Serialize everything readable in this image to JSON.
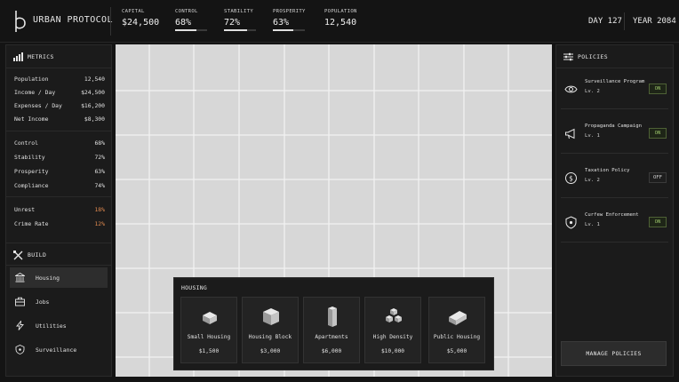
{
  "app": {
    "title": "URBAN PROTOCOL"
  },
  "topbar": {
    "stats": [
      {
        "label": "CAPITAL",
        "value": "$24,500"
      },
      {
        "label": "CONTROL",
        "value": "68%",
        "level": 0.68
      },
      {
        "label": "STABILITY",
        "value": "72%",
        "level": 0.72
      },
      {
        "label": "PROSPERITY",
        "value": "63%",
        "level": 0.63
      },
      {
        "label": "POPULATION",
        "value": "12,540"
      }
    ],
    "day": "DAY 127",
    "year": "YEAR 2084"
  },
  "metrics": {
    "title": "METRICS",
    "economy": [
      {
        "label": "Population",
        "value": "12,540"
      },
      {
        "label": "Income / Day",
        "value": "$24,500"
      },
      {
        "label": "Expenses / Day",
        "value": "$16,200"
      },
      {
        "label": "Net Income",
        "value": "$8,300"
      }
    ],
    "indices": [
      {
        "label": "Control",
        "value": "68%"
      },
      {
        "label": "Stability",
        "value": "72%"
      },
      {
        "label": "Prosperity",
        "value": "63%"
      },
      {
        "label": "Compliance",
        "value": "74%"
      }
    ],
    "risks": [
      {
        "label": "Unrest",
        "value": "18%"
      },
      {
        "label": "Crime Rate",
        "value": "12%"
      }
    ]
  },
  "build": {
    "title": "BUILD",
    "items": [
      {
        "label": "Housing",
        "icon": "building-columns-icon",
        "active": true
      },
      {
        "label": "Jobs",
        "icon": "briefcase-icon",
        "active": false
      },
      {
        "label": "Utilities",
        "icon": "lightning-bolt-icon",
        "active": false
      },
      {
        "label": "Surveillance",
        "icon": "shield-icon",
        "active": false
      }
    ]
  },
  "housing": {
    "title": "HOUSING",
    "cards": [
      {
        "name": "Small Housing",
        "price": "$1,500",
        "icon": "small-house-cube-icon"
      },
      {
        "name": "Housing Block",
        "price": "$3,000",
        "icon": "housing-block-cube-icon"
      },
      {
        "name": "Apartments",
        "price": "$6,000",
        "icon": "apartment-tower-icon"
      },
      {
        "name": "High Density",
        "price": "$10,000",
        "icon": "stacked-cubes-icon"
      },
      {
        "name": "Public Housing",
        "price": "$5,000",
        "icon": "long-block-icon"
      }
    ]
  },
  "policies": {
    "title": "POLICIES",
    "items": [
      {
        "name": "Surveillance Program",
        "level": "Lv. 2",
        "state": "ON",
        "icon": "eye-icon"
      },
      {
        "name": "Propaganda Campaign",
        "level": "Lv. 1",
        "state": "ON",
        "icon": "megaphone-icon"
      },
      {
        "name": "Taxation Policy",
        "level": "Lv. 2",
        "state": "OFF",
        "icon": "coin-icon"
      },
      {
        "name": "Curfew Enforcement",
        "level": "Lv. 1",
        "state": "ON",
        "icon": "shield-icon"
      }
    ],
    "manage_label": "MANAGE POLICIES"
  },
  "colors": {
    "background": "#141414",
    "panel": "#1b1b1b",
    "map": "#d7d7d7",
    "accent_on": "#9bc46a",
    "warning": "#e08a50"
  }
}
